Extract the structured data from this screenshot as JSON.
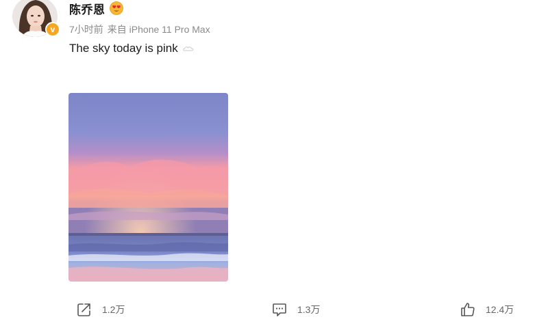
{
  "author": {
    "name": "陈乔恩",
    "verified_badge": "v"
  },
  "meta": {
    "time": "7小时前",
    "source": "来自 iPhone 11 Pro Max"
  },
  "post": {
    "text": "The sky today is pink",
    "emoji": "cloud-emoji"
  },
  "actions": {
    "share_count": "1.2万",
    "comment_count": "1.3万",
    "like_count": "12.4万"
  },
  "colors": {
    "badge": "#f5a623",
    "text_primary": "#1a1a1a",
    "text_secondary": "#8a8a8a",
    "action_text": "#666666"
  }
}
